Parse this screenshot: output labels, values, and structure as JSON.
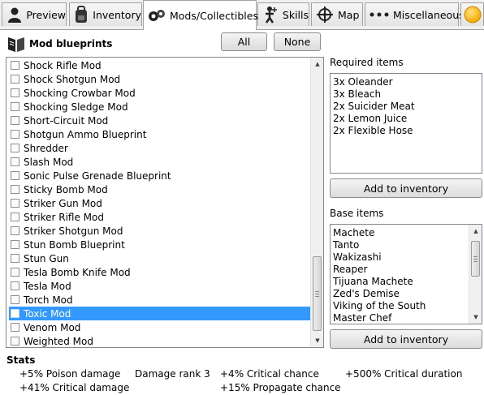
{
  "tabs": [
    {
      "label": "Preview",
      "icon": "person-icon"
    },
    {
      "label": "Inventory",
      "icon": "backpack-icon"
    },
    {
      "label": "Mods/Collectibles",
      "icon": "gears-icon",
      "active": true
    },
    {
      "label": "Skills",
      "icon": "skill-figure-icon"
    },
    {
      "label": "Map",
      "icon": "compass-icon"
    },
    {
      "label": "Miscellaneous",
      "icon": "dots-icon"
    },
    {
      "label": "",
      "icon": "orange-circle-icon"
    }
  ],
  "header": {
    "title": "Mod blueprints",
    "icon": "blueprint-icon"
  },
  "buttons": {
    "all": "All",
    "none": "None"
  },
  "mod_list": {
    "items": [
      "Shock Rifle Mod",
      "Shock Shotgun Mod",
      "Shocking Crowbar Mod",
      "Shocking Sledge Mod",
      "Short-Circuit Mod",
      "Shotgun Ammo Blueprint",
      "Shredder",
      "Slash Mod",
      "Sonic Pulse Grenade Blueprint",
      "Sticky Bomb Mod",
      "Striker Gun Mod",
      "Striker Rifle Mod",
      "Striker Shotgun Mod",
      "Stun Bomb Blueprint",
      "Stun Gun",
      "Tesla Bomb Knife Mod",
      "Tesla Mod",
      "Torch Mod",
      "Toxic Mod",
      "Venom Mod",
      "Weighted Mod"
    ],
    "selected": "Toxic Mod",
    "scroll_position": 0.93
  },
  "required": {
    "label": "Required items",
    "items": [
      "3x Oleander",
      "3x Bleach",
      "2x Suicider Meat",
      "2x Lemon Juice",
      "2x Flexible Hose"
    ],
    "button": "Add to inventory"
  },
  "base": {
    "label": "Base items",
    "items": [
      "Machete",
      "Tanto",
      "Wakizashi",
      "Reaper",
      "Tijuana Machete",
      "Zed's Demise",
      "Viking of the South",
      "Master Chef"
    ],
    "button": "Add to inventory",
    "scroll_position": 0.2
  },
  "stats": {
    "title": "Stats",
    "row1": [
      "+5% Poison damage",
      "Damage rank 3",
      "+4% Critical chance",
      "+500% Critical duration"
    ],
    "row2": [
      "+41% Critical damage",
      "+15% Propagate chance"
    ]
  },
  "colors": {
    "selection": "#3399ff",
    "tab_active_bg": "#ffffff",
    "accent_orange": "#f5a800"
  }
}
